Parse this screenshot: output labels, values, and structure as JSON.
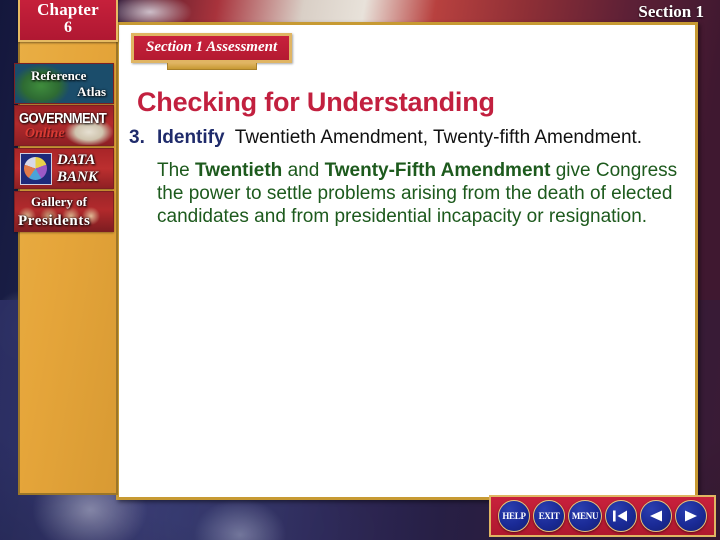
{
  "slide": {
    "chapter": {
      "word": "Chapter",
      "number": "6"
    },
    "section_label": "Section 1",
    "assessment_banner": "Section 1 Assessment",
    "headline": "Checking for Understanding"
  },
  "sidebar": {
    "buttons": [
      {
        "name": "reference-atlas",
        "line1": "Reference",
        "line2": "Atlas",
        "icon": "globe-map-icon"
      },
      {
        "name": "government-online",
        "line1": "GOVERNMENT",
        "line2": "Online",
        "icon": "open-book-icon"
      },
      {
        "name": "data-bank",
        "line1": "DATA",
        "line2": "BANK",
        "icon": "pie-chart-icon"
      },
      {
        "name": "gallery-of-presidents",
        "line1": "Gallery of",
        "line2": "Presidents",
        "icon": "presidents-portraits-icon"
      }
    ]
  },
  "question": {
    "number": "3.",
    "verb": "Identify",
    "prompt": "Twentieth Amendment, Twenty-fifth Amendment.",
    "answer": {
      "lead": "The ",
      "bold1": "Twentieth",
      "mid": " and ",
      "bold2": "Twenty-Fifth Amendment",
      "rest": " give Congress the power to settle problems arising from the death of elected candidates and from presidential incapacity or resignation."
    }
  },
  "navigation": {
    "help_label": "HELP",
    "exit_label": "EXIT",
    "menu_label": "MENU",
    "first_slide_icon": "first-slide-arrow-icon",
    "previous_icon": "previous-arrow-icon",
    "next_icon": "next-arrow-icon"
  },
  "colors": {
    "crimson": "#c2203f",
    "gold": "#c79a33",
    "panel_gold": "#e5a53a",
    "navy_text": "#1f2b6b",
    "answer_green": "#1d5a1d",
    "button_blue": "#1a2a96"
  }
}
